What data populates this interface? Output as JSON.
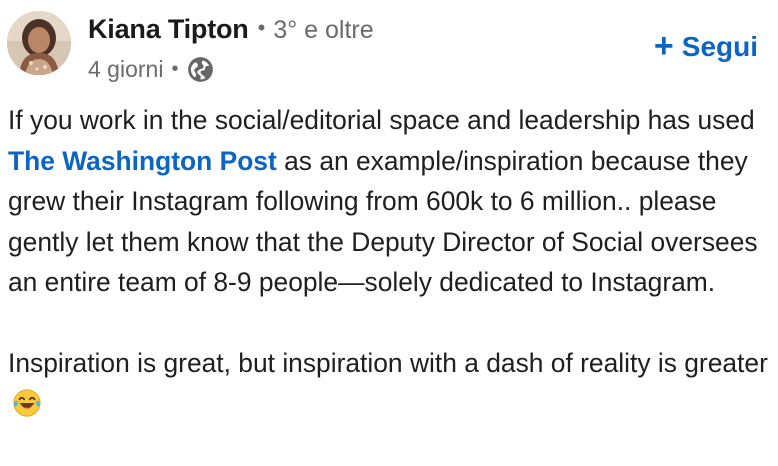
{
  "author": {
    "name": "Kiana Tipton",
    "connection_degree": "3° e oltre",
    "time_ago": "4 giorni",
    "visibility_icon": "globe-icon",
    "avatar_icon": "avatar"
  },
  "follow": {
    "label": "Segui",
    "icon": "plus-icon"
  },
  "post": {
    "p1_part1": "If you work in the social/editorial space and leadership has used ",
    "mention": "The Washington Post",
    "p1_part2": " as an example/inspiration because they grew their Instagram following from 600k to 6 million.. please gently let them know that the Deputy Director of Social oversees an entire team of 8-9 people—solely dedicated to Instagram.",
    "p2": "Inspiration is great, but inspiration with a dash of reality is greater",
    "emoji": "laughing-tears-emoji"
  },
  "colors": {
    "link": "#0a66c2",
    "text": "#1f1f1f",
    "muted": "#6b6b6b"
  }
}
